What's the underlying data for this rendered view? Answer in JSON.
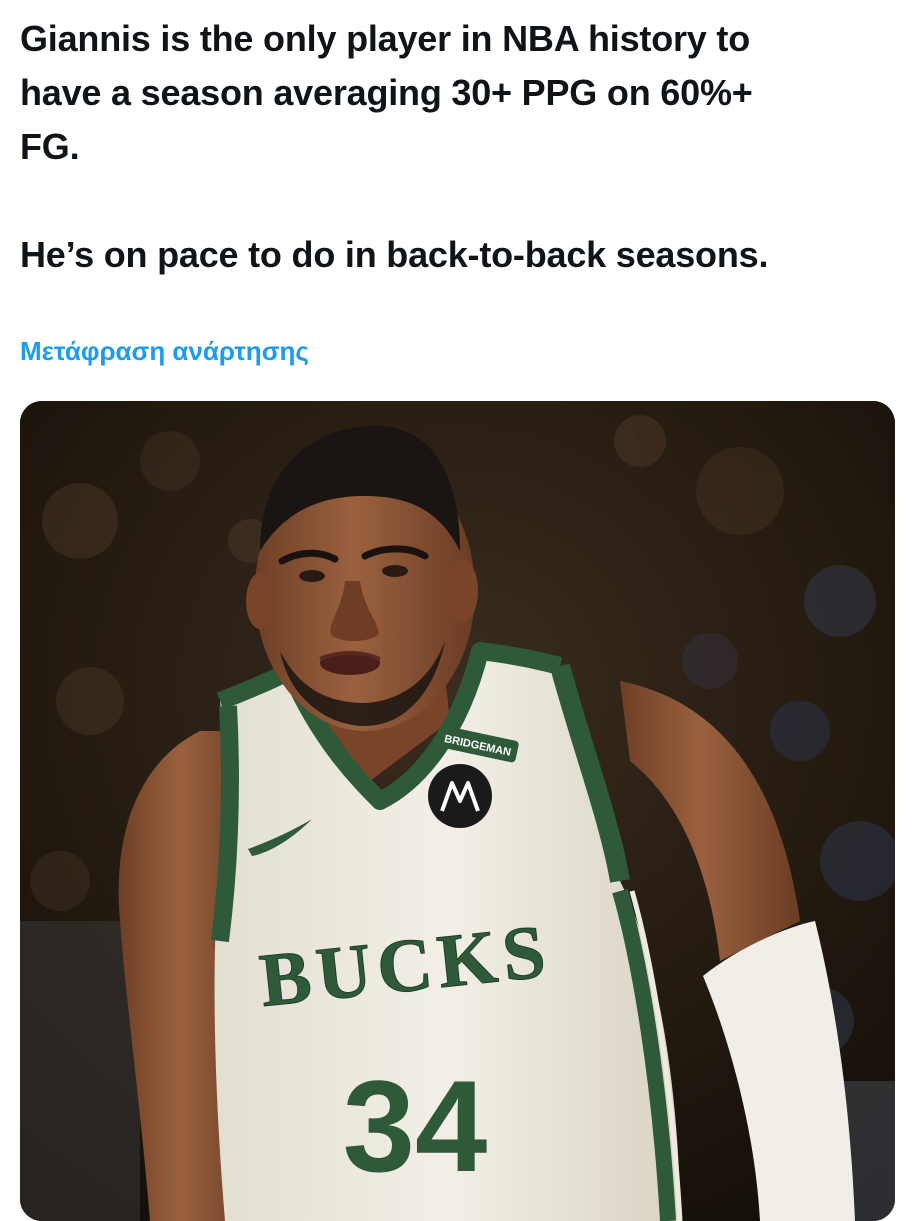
{
  "tweet": {
    "line1": "Giannis is the only player in NBA history to",
    "line2": "have a season averaging 30+ PPG on 60%+",
    "line3": "FG.",
    "line4": "He’s on pace to do in back-to-back seasons."
  },
  "translate": {
    "label": "Μετάφραση ανάρτησης"
  },
  "media": {
    "jersey_team": "BUCKS",
    "jersey_number": "34",
    "patch_text": "BRIDGEMAN",
    "colors": {
      "jersey_cream": "#eeeae0",
      "bucks_green": "#2e5a3a",
      "skin": "#8a5436",
      "background": "#241b14",
      "link": "#1d9bf0"
    }
  }
}
